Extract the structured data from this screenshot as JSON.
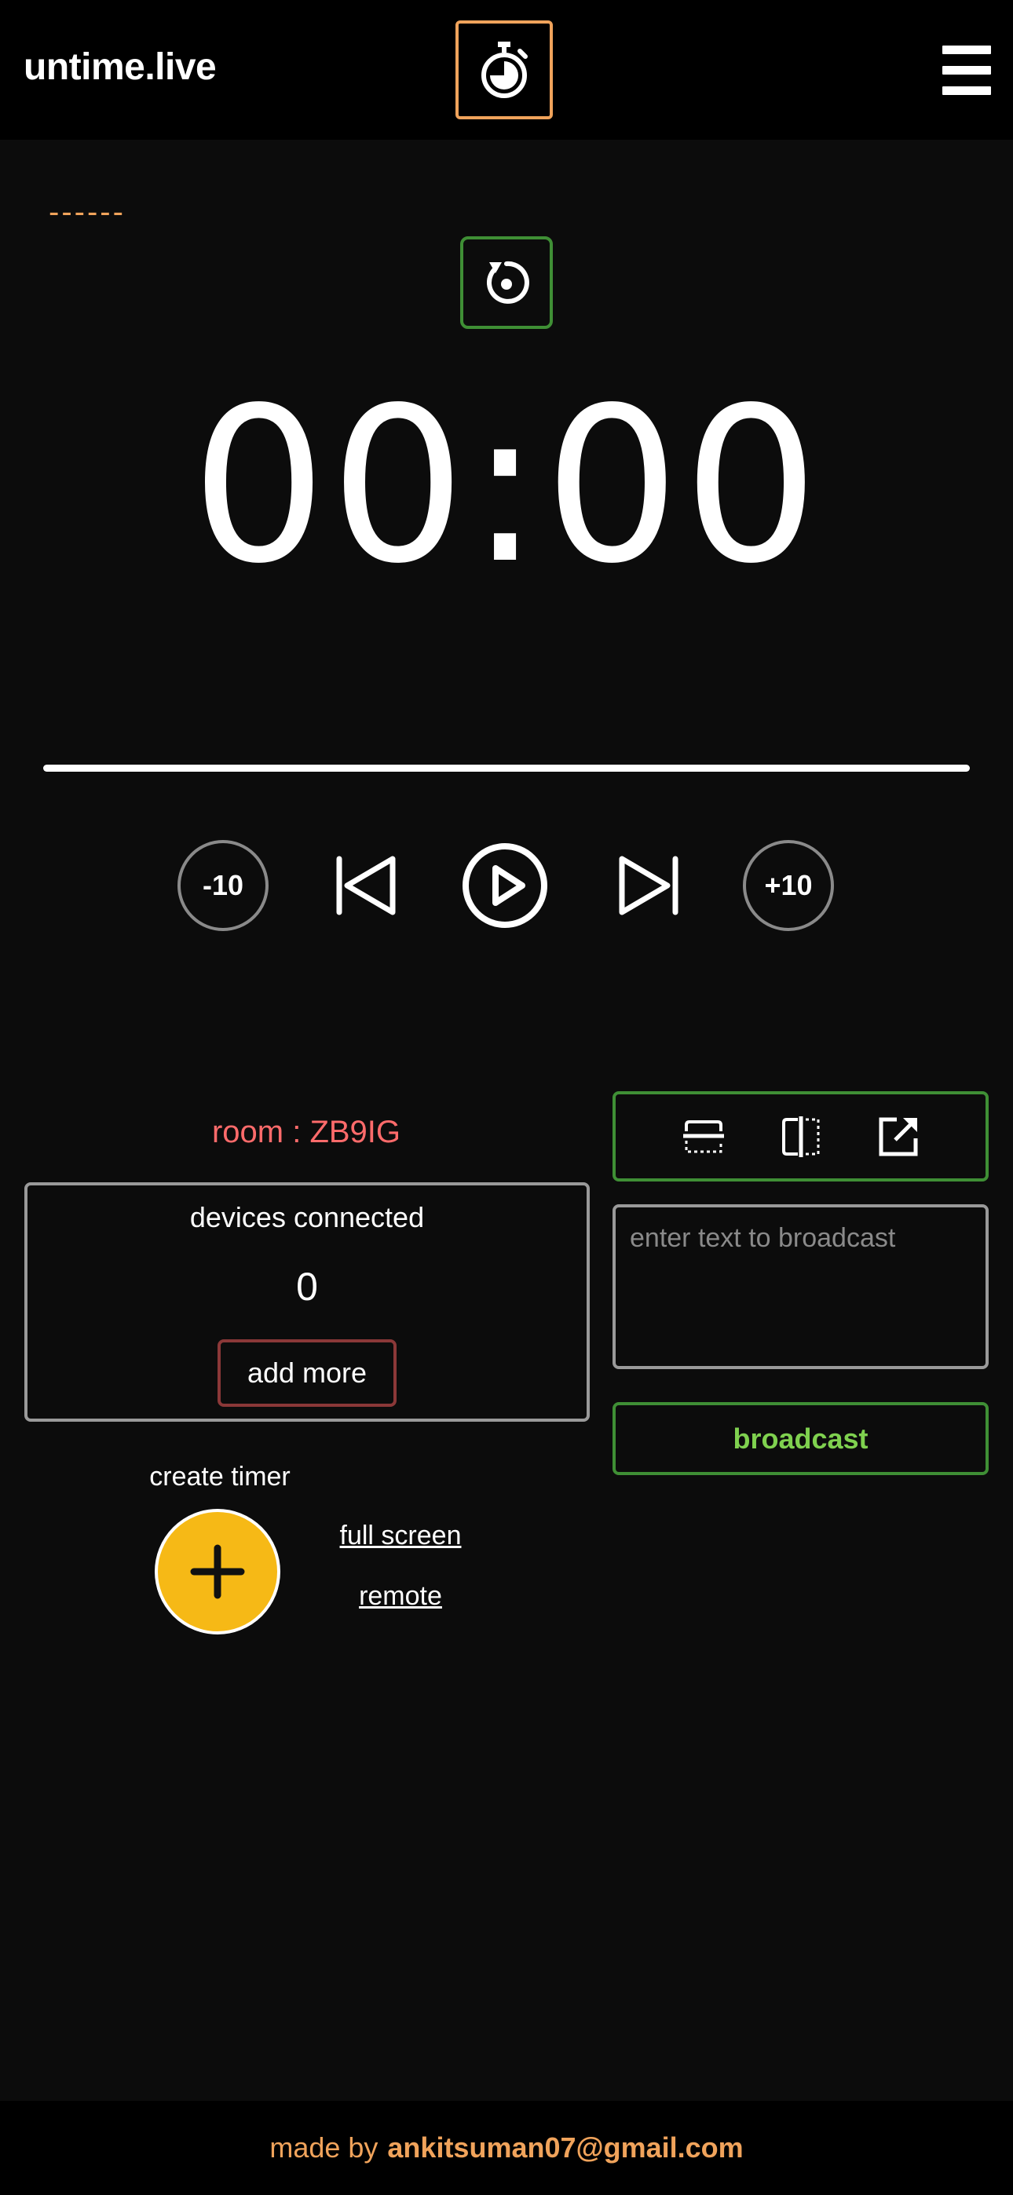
{
  "header": {
    "brand": "untime.live",
    "logo_icon": "stopwatch-icon",
    "menu_icon": "hamburger-menu-icon"
  },
  "timer": {
    "message": "------",
    "display": "00:00",
    "progress_fraction": 1.0,
    "reset_icon": "reset-icon"
  },
  "controls": {
    "minus_label": "-10",
    "plus_label": "+10",
    "prev_icon": "skip-previous-icon",
    "play_icon": "play-icon",
    "next_icon": "skip-next-icon"
  },
  "room": {
    "label": "room : ZB9IG",
    "devices_title": "devices connected",
    "devices_count": "0",
    "add_more_label": "add more"
  },
  "actions": {
    "create_timer_label": "create timer",
    "full_screen_label": "full screen",
    "remote_label": "remote"
  },
  "broadcast": {
    "placeholder": "enter text to broadcast",
    "value": "",
    "button_label": "broadcast",
    "layout_icons": [
      "bottom-banner-icon",
      "split-vertical-icon",
      "open-external-icon"
    ]
  },
  "footer": {
    "prefix": "made by",
    "email": "ankitsuman07@gmail.com"
  },
  "colors": {
    "accent_orange": "#f0a35b",
    "green": "#3f8f35",
    "room_red": "#ff6b6b",
    "yellow": "#f6b916"
  }
}
